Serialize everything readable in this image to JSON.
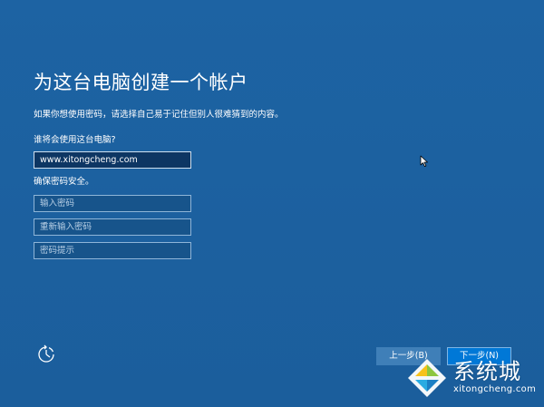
{
  "page": {
    "title": "为这台电脑创建一个帐户",
    "description": "如果你想使用密码，请选择自己易于记住但别人很难猜到的内容。",
    "who_label": "谁将会使用这台电脑?",
    "security_label": "确保密码安全。"
  },
  "fields": {
    "username_value": "www.xitongcheng.com",
    "password_placeholder": "输入密码",
    "password_confirm_placeholder": "重新输入密码",
    "password_hint_placeholder": "密码提示"
  },
  "buttons": {
    "back_label": "上一步(B)",
    "next_label": "下一步(N)"
  },
  "icons": {
    "ease_of_access": "ease-of-access-icon",
    "cursor": "mouse-cursor-icon",
    "watermark_logo": "xitongcheng-logo-icon"
  },
  "watermark": {
    "brand": "系统城",
    "url": "xitongcheng.com"
  },
  "colors": {
    "background": "#1b5f9e",
    "next_button": "#0078d7",
    "back_button": "#3f7fb8",
    "filled_field": "#0d3663"
  }
}
